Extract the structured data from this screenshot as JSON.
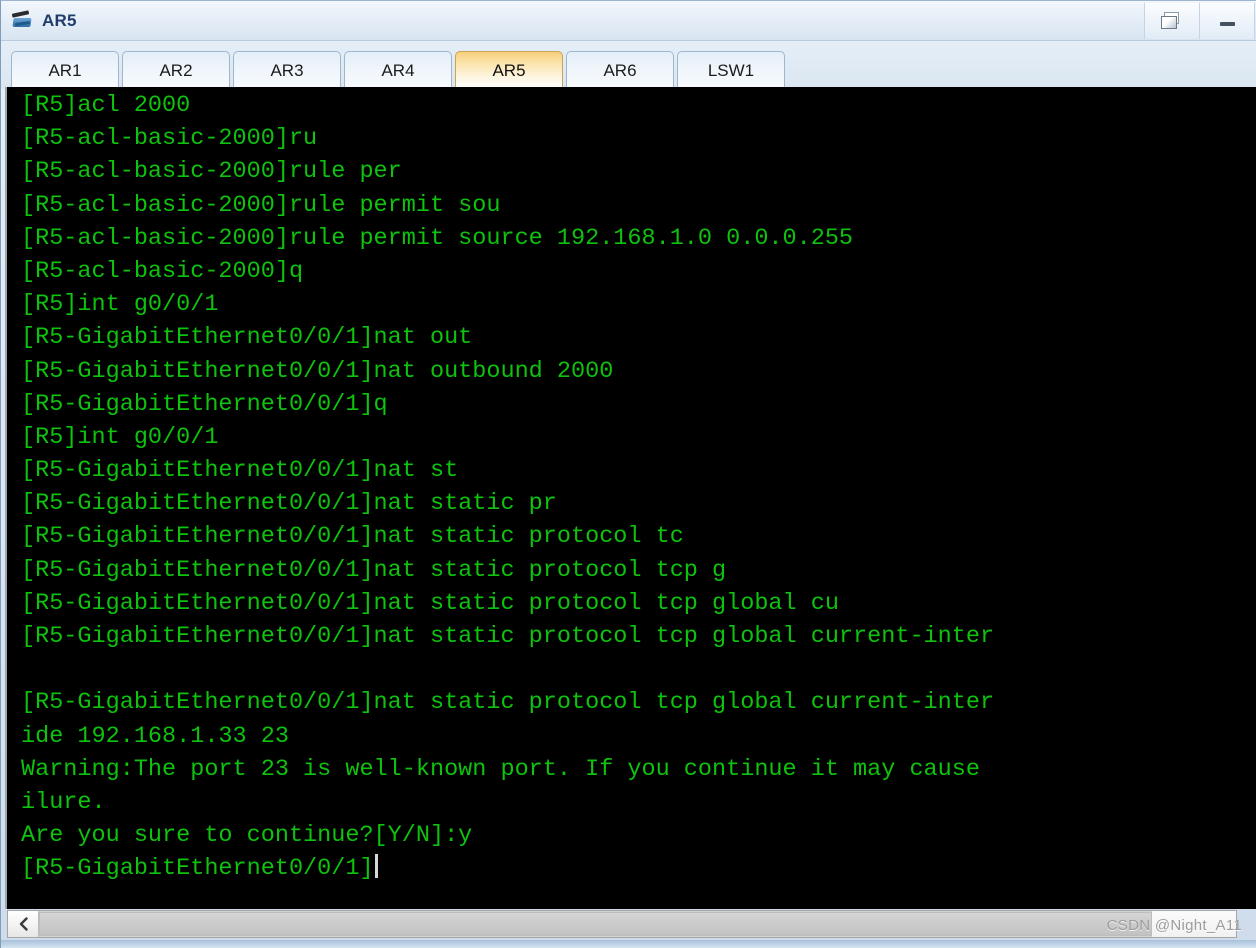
{
  "window": {
    "title": "AR5",
    "icon": "router-icon",
    "buttons": {
      "restore": "restore-window",
      "minimize": "minimize-window"
    }
  },
  "tabs": [
    {
      "label": "AR1",
      "active": false
    },
    {
      "label": "AR2",
      "active": false
    },
    {
      "label": "AR3",
      "active": false
    },
    {
      "label": "AR4",
      "active": false
    },
    {
      "label": "AR5",
      "active": true
    },
    {
      "label": "AR6",
      "active": false
    },
    {
      "label": "LSW1",
      "active": false
    }
  ],
  "terminal": {
    "foreground": "#0ec20e",
    "background": "#000000",
    "lines": [
      "[R5]acl 2000",
      "[R5-acl-basic-2000]ru",
      "[R5-acl-basic-2000]rule per",
      "[R5-acl-basic-2000]rule permit sou",
      "[R5-acl-basic-2000]rule permit source 192.168.1.0 0.0.0.255",
      "[R5-acl-basic-2000]q",
      "[R5]int g0/0/1",
      "[R5-GigabitEthernet0/0/1]nat out",
      "[R5-GigabitEthernet0/0/1]nat outbound 2000",
      "[R5-GigabitEthernet0/0/1]q",
      "[R5]int g0/0/1",
      "[R5-GigabitEthernet0/0/1]nat st",
      "[R5-GigabitEthernet0/0/1]nat static pr",
      "[R5-GigabitEthernet0/0/1]nat static protocol tc",
      "[R5-GigabitEthernet0/0/1]nat static protocol tcp g",
      "[R5-GigabitEthernet0/0/1]nat static protocol tcp global cu",
      "[R5-GigabitEthernet0/0/1]nat static protocol tcp global current-inter",
      "",
      "[R5-GigabitEthernet0/0/1]nat static protocol tcp global current-inter",
      "ide 192.168.1.33 23",
      "Warning:The port 23 is well-known port. If you continue it may cause",
      "ilure.",
      "Are you sure to continue?[Y/N]:y",
      "[R5-GigabitEthernet0/0/1]"
    ],
    "prompt_line_index": 23,
    "cursor_visible": true
  },
  "scrollbar": {
    "orientation": "horizontal",
    "left_arrow": "chevron-left-icon",
    "thumb_fraction_percent": 93
  },
  "watermark": {
    "text": "CSDN @Night_A11"
  }
}
